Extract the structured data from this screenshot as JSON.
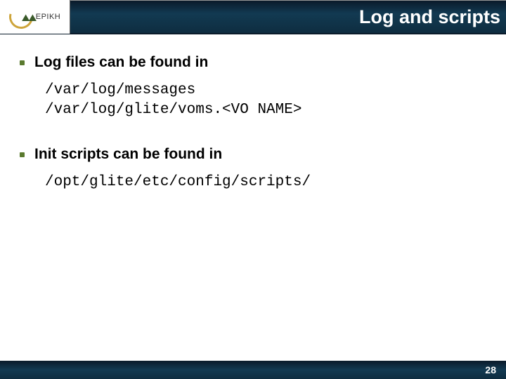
{
  "header": {
    "logo_text": "EPIKH",
    "title": "Log and scripts"
  },
  "content": {
    "bullets": [
      {
        "text": "Log files can be found in"
      },
      {
        "text": "Init scripts can be found in"
      }
    ],
    "code_blocks": [
      {
        "lines": [
          "/var/log/messages",
          "/var/log/glite/voms.<VO NAME>"
        ]
      },
      {
        "lines": [
          "/opt/glite/etc/config/scripts/"
        ]
      }
    ]
  },
  "footer": {
    "page_number": "28"
  }
}
